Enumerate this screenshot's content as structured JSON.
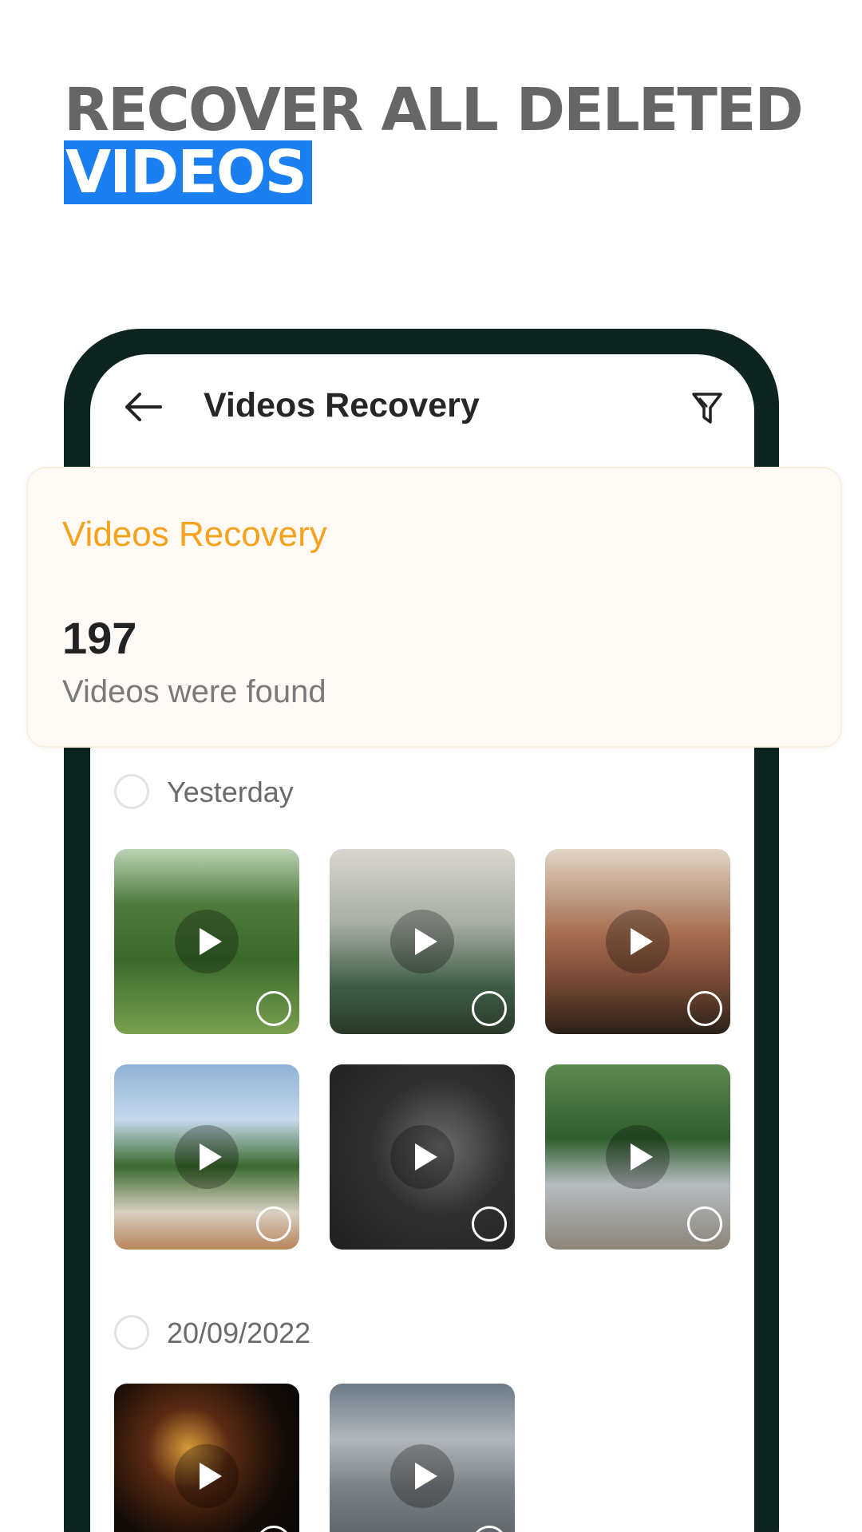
{
  "headline": {
    "line1": "RECOVER ALL DELETED",
    "line2": "VIDEOS"
  },
  "colors": {
    "accent_blue": "#1a7ff0",
    "accent_orange": "#f6a21c",
    "phone_frame": "#0d2420"
  },
  "app_bar": {
    "title": "Videos Recovery",
    "back_icon": "arrow-left-icon",
    "filter_icon": "filter-icon"
  },
  "summary": {
    "title": "Videos Recovery",
    "count": "197",
    "subtitle": "Videos were found"
  },
  "sections": [
    {
      "label": "Yesterday",
      "videos": 6
    },
    {
      "label": "20/09/2022",
      "videos": 2
    }
  ]
}
